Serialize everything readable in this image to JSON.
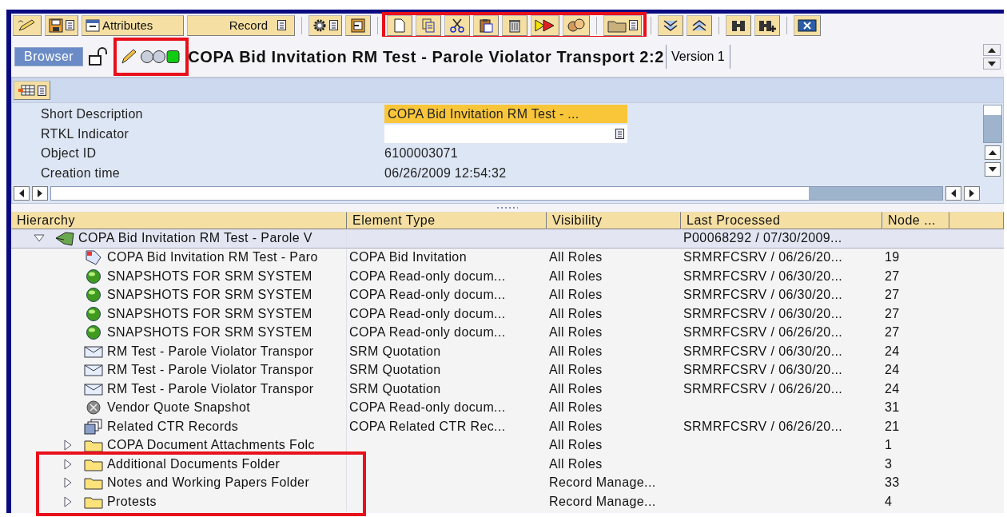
{
  "toolbar": {
    "buttons": [
      {
        "label": "Attributes"
      },
      {
        "label": "Record"
      }
    ],
    "edit_group_highlighted": true
  },
  "header": {
    "tab": {
      "label": "Browser",
      "selected": true
    },
    "status_highlighted": true,
    "title": "COPA Bid Invitation RM Test - Parole Violator Transport 2:2",
    "version": "Version 1"
  },
  "details": {
    "fields": [
      {
        "label": "Short Description",
        "value": "COPA Bid Invitation RM Test - ...",
        "kind": "input",
        "focused": true
      },
      {
        "label": "RTKL Indicator",
        "kind": "dropdown",
        "focused": false
      },
      {
        "label": "Object ID",
        "value": "6100003071",
        "kind": "text",
        "focused": false
      },
      {
        "label": "Creation time",
        "value": "06/26/2009 12:54:32",
        "kind": "text",
        "focused": false
      }
    ]
  },
  "tree": {
    "columns": [
      "Hierarchy",
      "Element Type",
      "Visibility",
      "Last Processed",
      "Node ..."
    ],
    "rows": [
      {
        "label": "COPA Bid Invitation RM Test - Parole V",
        "kind": "record",
        "last_processed": "P00068292 / 07/30/2009...",
        "expanded": true,
        "selected": true,
        "children": [
          {
            "label": "COPA Bid Invitation RM Test - Paro",
            "kind": "bid",
            "element_type": "COPA Bid Invitation",
            "visibility": "All Roles",
            "last_processed": "SRMRFCSRV / 06/26/20...",
            "node": "19",
            "selected": false,
            "highlighted": false
          },
          {
            "label": "SNAPSHOTS FOR SRM SYSTEM",
            "kind": "snapshot",
            "element_type": "COPA Read-only docum...",
            "visibility": "All Roles",
            "last_processed": "SRMRFCSRV / 06/30/20...",
            "node": "27",
            "selected": false,
            "highlighted": false
          },
          {
            "label": "SNAPSHOTS FOR SRM SYSTEM",
            "kind": "snapshot",
            "element_type": "COPA Read-only docum...",
            "visibility": "All Roles",
            "last_processed": "SRMRFCSRV / 06/30/20...",
            "node": "27",
            "selected": false,
            "highlighted": false
          },
          {
            "label": "SNAPSHOTS FOR SRM SYSTEM",
            "kind": "snapshot",
            "element_type": "COPA Read-only docum...",
            "visibility": "All Roles",
            "last_processed": "SRMRFCSRV / 06/30/20...",
            "node": "27",
            "selected": false,
            "highlighted": false
          },
          {
            "label": "SNAPSHOTS FOR SRM SYSTEM",
            "kind": "snapshot",
            "element_type": "COPA Read-only docum...",
            "visibility": "All Roles",
            "last_processed": "SRMRFCSRV / 06/26/20...",
            "node": "27",
            "selected": false,
            "highlighted": false
          },
          {
            "label": "RM Test - Parole Violator Transpor",
            "kind": "quotation",
            "element_type": "SRM Quotation",
            "visibility": "All Roles",
            "last_processed": "SRMRFCSRV / 06/30/20...",
            "node": "24",
            "selected": false,
            "highlighted": false
          },
          {
            "label": "RM Test - Parole Violator Transpor",
            "kind": "quotation",
            "element_type": "SRM Quotation",
            "visibility": "All Roles",
            "last_processed": "SRMRFCSRV / 06/30/20...",
            "node": "24",
            "selected": false,
            "highlighted": false
          },
          {
            "label": "RM Test - Parole Violator Transpor",
            "kind": "quotation",
            "element_type": "SRM Quotation",
            "visibility": "All Roles",
            "last_processed": "SRMRFCSRV / 06/26/20...",
            "node": "24",
            "selected": false,
            "highlighted": false
          },
          {
            "label": "Vendor Quote Snapshot",
            "kind": "vendor",
            "element_type": "COPA Read-only docum...",
            "visibility": "All Roles",
            "node": "31",
            "selected": false,
            "highlighted": false
          },
          {
            "label": "Related CTR Records",
            "kind": "related",
            "element_type": "COPA Related CTR Rec...",
            "visibility": "All Roles",
            "last_processed": "SRMRFCSRV / 06/26/20...",
            "node": "21",
            "selected": false,
            "highlighted": false
          },
          {
            "label": "COPA Document Attachments Folc",
            "kind": "folder",
            "visibility": "All Roles",
            "node": "1",
            "expanded": false,
            "selected": false,
            "highlighted": false
          },
          {
            "label": "Additional Documents Folder",
            "kind": "folder",
            "visibility": "All Roles",
            "node": "3",
            "expanded": false,
            "selected": false,
            "highlighted": true
          },
          {
            "label": "Notes and Working Papers Folder",
            "kind": "folder",
            "visibility": "Record Manage...",
            "node": "33",
            "expanded": false,
            "selected": false,
            "highlighted": true
          },
          {
            "label": "Protests",
            "kind": "folder",
            "visibility": "Record Manage...",
            "node": "4",
            "expanded": false,
            "selected": false,
            "highlighted": true
          }
        ]
      }
    ]
  }
}
